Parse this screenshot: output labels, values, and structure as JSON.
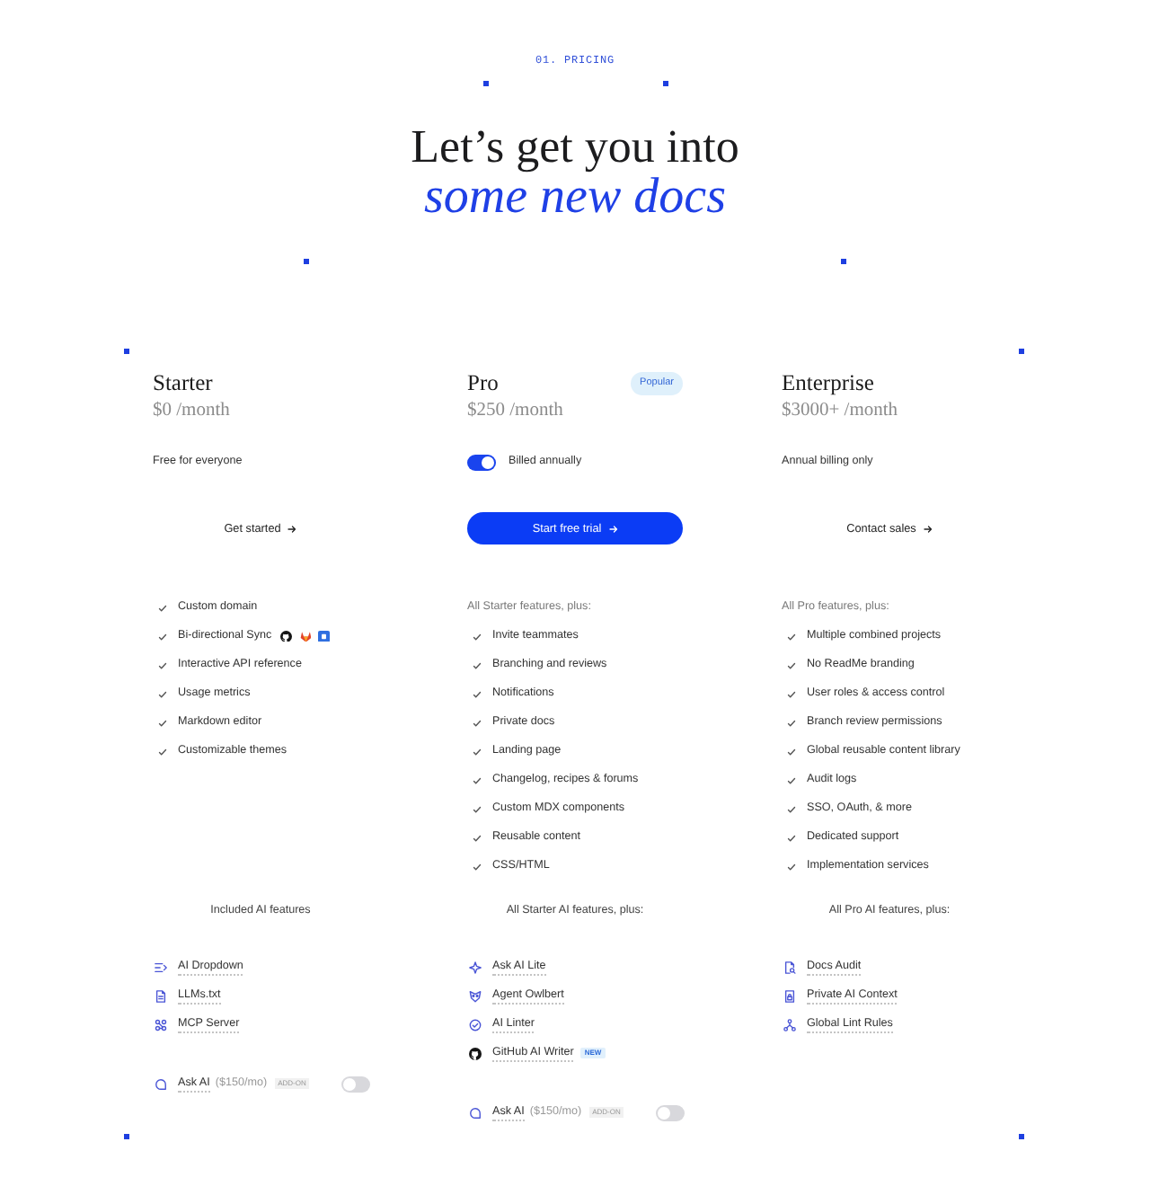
{
  "section_label": "01. PRICING",
  "headline": {
    "line_1": "Let’s get you into",
    "line_2": "some new docs"
  },
  "plans": [
    {
      "name": "Starter",
      "price": "$0 /month",
      "billing": {
        "label": "Free for everyone"
      },
      "cta": {
        "kind": "link",
        "label": "Get started"
      },
      "features": [
        {
          "kind": "plain",
          "label": "Custom domain"
        },
        {
          "kind": "integrations",
          "label": "Bi-directional Sync"
        },
        {
          "kind": "plain",
          "label": "Interactive API reference"
        },
        {
          "kind": "plain",
          "label": "Usage metrics"
        },
        {
          "kind": "plain",
          "label": "Markdown editor"
        },
        {
          "kind": "plain",
          "label": "Customizable themes"
        }
      ],
      "ai_heading": "Included AI features",
      "ai_features": [
        {
          "label": "AI Dropdown"
        },
        {
          "label": "LLMs.txt"
        },
        {
          "label": "MCP Server"
        }
      ],
      "add_on": {
        "label": "Ask AI",
        "price": "($150/mo)",
        "tag": "ADD-ON",
        "toggle": {
          "on": false
        }
      }
    },
    {
      "name": "Pro",
      "badge": "Popular",
      "price": "$250 /month",
      "billing": {
        "label": "Billed annually",
        "toggle": {
          "on": true
        }
      },
      "cta": {
        "kind": "button",
        "label": "Start free trial"
      },
      "features_intro": "All Starter features, plus:",
      "features": [
        {
          "kind": "plain",
          "label": "Invite teammates"
        },
        {
          "kind": "plain",
          "label": "Branching and reviews"
        },
        {
          "kind": "plain",
          "label": "Notifications"
        },
        {
          "kind": "plain",
          "label": "Private docs"
        },
        {
          "kind": "plain",
          "label": "Landing page"
        },
        {
          "kind": "plain",
          "label": "Changelog, recipes & forums"
        },
        {
          "kind": "plain",
          "label": "Custom MDX components"
        },
        {
          "kind": "plain",
          "label": "Reusable content"
        },
        {
          "kind": "plain",
          "label": "CSS/HTML"
        }
      ],
      "ai_heading": "All Starter AI features, plus:",
      "ai_features": [
        {
          "label": "Ask AI Lite"
        },
        {
          "label": "Agent Owlbert"
        },
        {
          "label": "AI Linter"
        },
        {
          "label": "GitHub AI Writer",
          "tag": "NEW"
        }
      ],
      "add_on": {
        "label": "Ask AI",
        "price": "($150/mo)",
        "tag": "ADD-ON",
        "toggle": {
          "on": false
        }
      }
    },
    {
      "name": "Enterprise",
      "price": "$3000+ /month",
      "billing": {
        "label": "Annual billing only"
      },
      "cta": {
        "kind": "link",
        "label": "Contact sales"
      },
      "features_intro": "All Pro features, plus:",
      "features": [
        {
          "kind": "plain",
          "label": "Multiple combined projects"
        },
        {
          "kind": "plain",
          "label": "No ReadMe branding"
        },
        {
          "kind": "plain",
          "label": "User roles & access control"
        },
        {
          "kind": "plain",
          "label": "Branch review permissions"
        },
        {
          "kind": "plain",
          "label": "Global reusable content library"
        },
        {
          "kind": "plain",
          "label": "Audit logs"
        },
        {
          "kind": "plain",
          "label": "SSO, OAuth, & more"
        },
        {
          "kind": "plain",
          "label": "Dedicated support"
        },
        {
          "kind": "plain",
          "label": "Implementation services"
        }
      ],
      "ai_heading": "All Pro AI features, plus:",
      "ai_features": [
        {
          "label": "Docs Audit"
        },
        {
          "label": "Private AI Context"
        },
        {
          "label": "Global Lint Rules"
        }
      ]
    }
  ]
}
